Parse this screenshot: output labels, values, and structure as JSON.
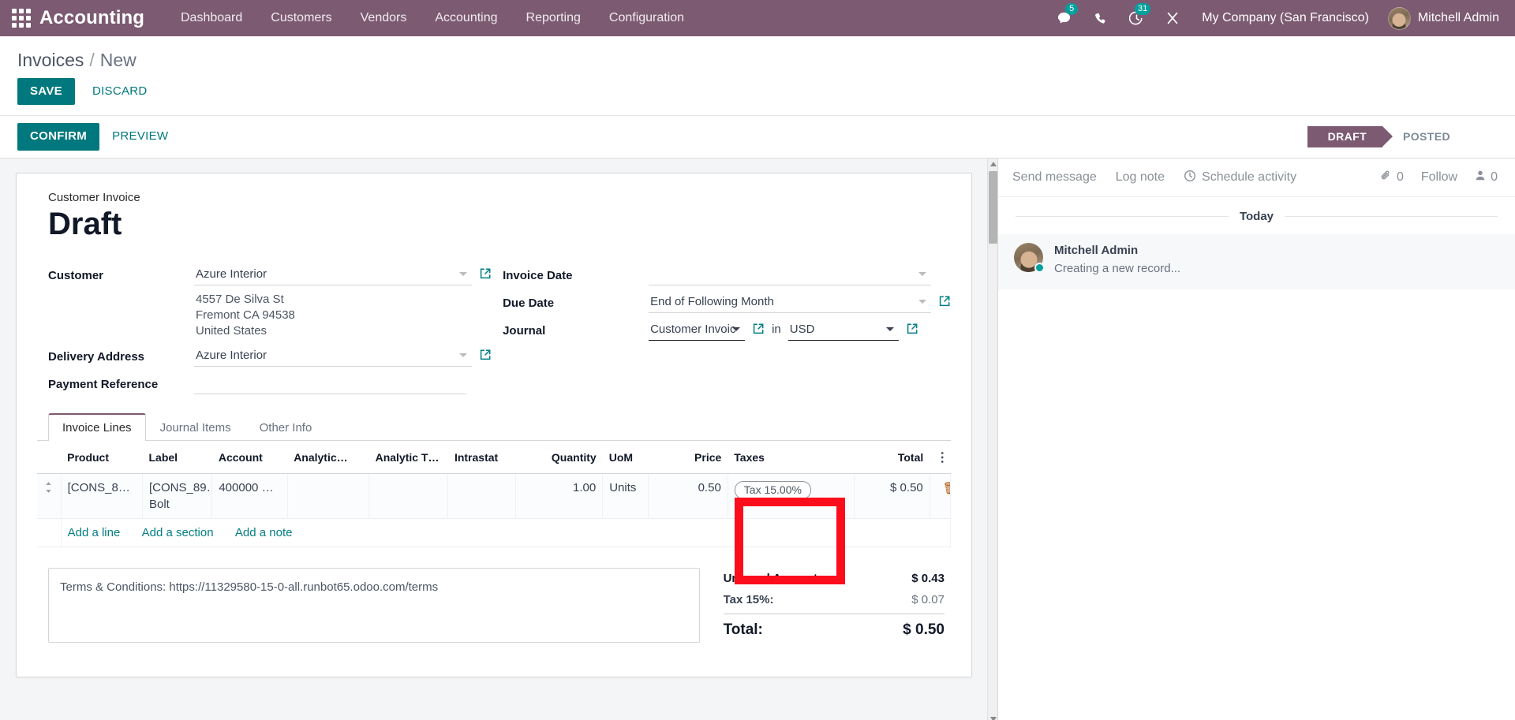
{
  "navbar": {
    "apps_icon": "apps-grid-icon",
    "brand": "Accounting",
    "menu": [
      {
        "label": "Dashboard"
      },
      {
        "label": "Customers"
      },
      {
        "label": "Vendors"
      },
      {
        "label": "Accounting"
      },
      {
        "label": "Reporting"
      },
      {
        "label": "Configuration"
      }
    ],
    "messages_icon": "chat-bubble-icon",
    "messages_count": "5",
    "phone_icon": "phone-icon",
    "activities_icon": "clock-icon",
    "activities_count": "31",
    "debug_icon": "wrench-icon",
    "company": "My Company (San Francisco)",
    "user": "Mitchell Admin",
    "avatar_icon": "user-avatar"
  },
  "breadcrumb": {
    "root": "Invoices",
    "separator": "/",
    "current": "New"
  },
  "top_buttons": {
    "save": "SAVE",
    "discard": "DISCARD"
  },
  "sheet_buttons": {
    "confirm": "CONFIRM",
    "preview": "PREVIEW"
  },
  "statusbar": {
    "steps": [
      {
        "label": "DRAFT",
        "active": true
      },
      {
        "label": "POSTED",
        "active": false
      }
    ]
  },
  "record": {
    "doc_type": "Customer Invoice",
    "title": "Draft",
    "fields": {
      "customer_label": "Customer",
      "customer_value": "Azure Interior",
      "customer_address": [
        "4557 De Silva St",
        "Fremont CA 94538",
        "United States"
      ],
      "delivery_address_label": "Delivery Address",
      "delivery_address_value": "Azure Interior",
      "payment_reference_label": "Payment Reference",
      "payment_reference_value": "",
      "invoice_date_label": "Invoice Date",
      "invoice_date_value": "",
      "due_date_label": "Due Date",
      "due_date_value": "End of Following Month",
      "journal_label": "Journal",
      "journal_value": "Customer Invoic",
      "journal_in": "in",
      "currency_value": "USD"
    }
  },
  "notebook": {
    "tabs": [
      {
        "label": "Invoice Lines",
        "active": true
      },
      {
        "label": "Journal Items",
        "active": false
      },
      {
        "label": "Other Info",
        "active": false
      }
    ]
  },
  "lines_table": {
    "columns": [
      "Product",
      "Label",
      "Account",
      "Analytic…",
      "Analytic T…",
      "Intrastat",
      "Quantity",
      "UoM",
      "Price",
      "Taxes",
      "Total"
    ],
    "optional_columns_icon": "vertical-dots-icon",
    "rows": [
      {
        "drag_handle_icon": "drag-handle-icon",
        "product": "[CONS_89…",
        "label": "[CONS_89…",
        "label_second_line": "Bolt",
        "account": "400000 P…",
        "analytic": "",
        "analytic_tags": "",
        "intrastat": "",
        "quantity": "1.00",
        "uom": "Units",
        "price": "0.50",
        "taxes": "Tax 15.00%",
        "total": "$ 0.50",
        "delete_icon": "trash-icon"
      }
    ],
    "add_links": [
      {
        "label": "Add a line"
      },
      {
        "label": "Add a section"
      },
      {
        "label": "Add a note"
      }
    ]
  },
  "terms": {
    "text": "Terms & Conditions: https://11329580-15-0-all.runbot65.odoo.com/terms"
  },
  "totals": [
    {
      "label": "Untaxed Amount:",
      "value": "$ 0.43",
      "style": "normal"
    },
    {
      "label": "Tax 15%:",
      "value": "$ 0.07",
      "style": "light"
    },
    {
      "label": "Total:",
      "value": "$ 0.50",
      "style": "grand"
    }
  ],
  "chatter": {
    "send_message": "Send message",
    "log_note": "Log note",
    "schedule_activity": "Schedule activity",
    "schedule_icon": "clock-icon",
    "attachment_icon": "paperclip-icon",
    "attachment_count": "0",
    "follow": "Follow",
    "followers_icon": "person-icon",
    "followers_count": "0",
    "date_separator": "Today",
    "messages": [
      {
        "author": "Mitchell Admin",
        "body": "Creating a new record...",
        "avatar_icon": "user-avatar",
        "status": "online"
      }
    ]
  },
  "annotation": {
    "type": "red-highlight-box",
    "target": "taxes-column"
  },
  "colors": {
    "navbar": "#7c5a72",
    "primary": "#00787d",
    "badge": "#00a09d",
    "status_active": "#7c5a72",
    "annotation": "#fc0d1c"
  }
}
